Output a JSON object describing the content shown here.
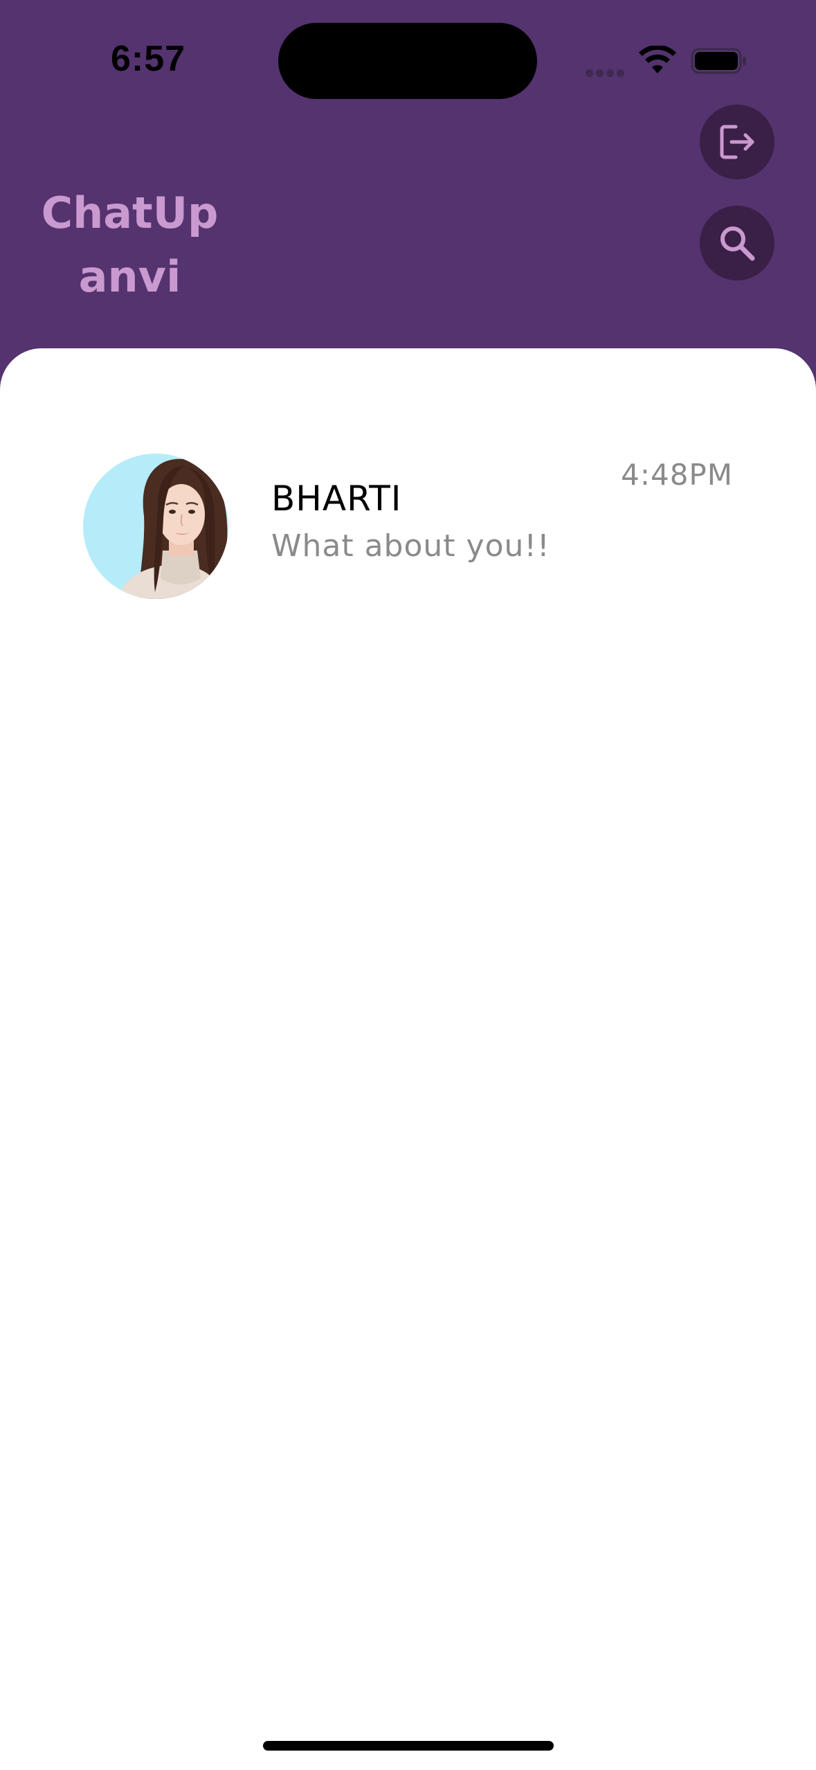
{
  "status_bar": {
    "time": "6:57",
    "icons": [
      "signal-dots-icon",
      "wifi-icon",
      "battery-icon"
    ]
  },
  "header": {
    "app_name": "ChatUp",
    "user_name": "anvi",
    "actions": [
      "logout-icon",
      "search-icon"
    ]
  },
  "chats": [
    {
      "name": "BHARTI",
      "last_message": "What about you!!",
      "time": "4:48PM",
      "avatar": "contact-avatar"
    }
  ],
  "colors": {
    "header_bg": "#54336f",
    "header_text": "#c999cf",
    "button_bg": "#3a1f47",
    "icon_color": "#c999cf",
    "card_bg": "#ffffff",
    "secondary_text": "#8a8a8a"
  }
}
